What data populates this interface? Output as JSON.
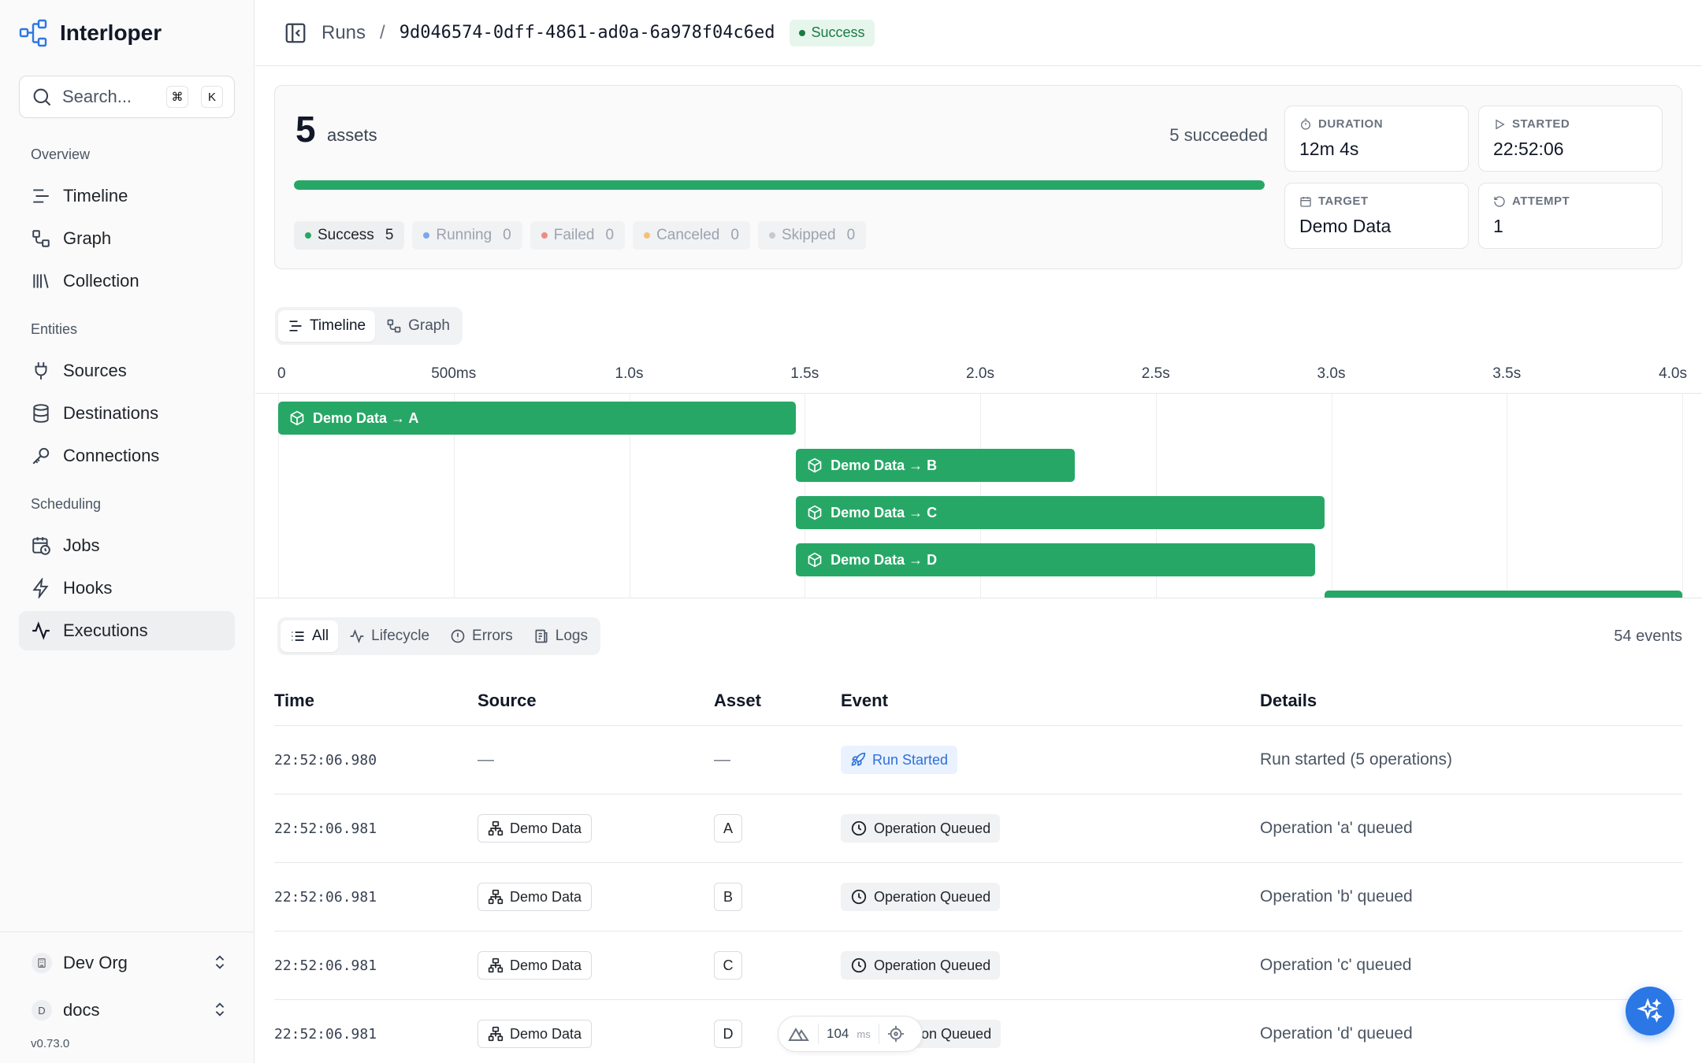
{
  "app": {
    "name": "Interloper",
    "version": "v0.73.0"
  },
  "search": {
    "placeholder": "Search...",
    "shortcut_mod": "⌘",
    "shortcut_key": "K"
  },
  "sidebar": {
    "sections": [
      {
        "title": "Overview",
        "items": [
          {
            "label": "Timeline",
            "icon": "timeline-icon"
          },
          {
            "label": "Graph",
            "icon": "graph-icon"
          },
          {
            "label": "Collection",
            "icon": "library-icon"
          }
        ]
      },
      {
        "title": "Entities",
        "items": [
          {
            "label": "Sources",
            "icon": "plug-icon"
          },
          {
            "label": "Destinations",
            "icon": "database-icon"
          },
          {
            "label": "Connections",
            "icon": "key-icon"
          }
        ]
      },
      {
        "title": "Scheduling",
        "items": [
          {
            "label": "Jobs",
            "icon": "calendar-clock-icon"
          },
          {
            "label": "Hooks",
            "icon": "zap-icon"
          },
          {
            "label": "Executions",
            "icon": "activity-icon",
            "active": true
          }
        ]
      }
    ],
    "org": {
      "name": "Dev Org"
    },
    "project": {
      "initial": "D",
      "name": "docs"
    }
  },
  "header": {
    "breadcrumb_root": "Runs",
    "separator": "/",
    "run_id": "9d046574-0dff-4861-ad0a-6a978f04c6ed",
    "status": "Success",
    "status_color": "#27a766"
  },
  "summary": {
    "asset_count": "5",
    "asset_word": "assets",
    "succeeded_text": "5 succeeded",
    "progress_fraction": 1.0,
    "chips": [
      {
        "label": "Success",
        "count": "5",
        "color": "#27a766",
        "active": true
      },
      {
        "label": "Running",
        "count": "0",
        "color": "#7aa7f0"
      },
      {
        "label": "Failed",
        "count": "0",
        "color": "#ef8a82"
      },
      {
        "label": "Canceled",
        "count": "0",
        "color": "#f5c07a"
      },
      {
        "label": "Skipped",
        "count": "0",
        "color": "#c7c9cc"
      }
    ],
    "stats": [
      {
        "label": "DURATION",
        "value": "12m 4s",
        "icon": "timer-icon"
      },
      {
        "label": "STARTED",
        "value": "22:52:06",
        "icon": "play-icon"
      },
      {
        "label": "TARGET",
        "value": "Demo Data",
        "icon": "calendar-icon"
      },
      {
        "label": "ATTEMPT",
        "value": "1",
        "icon": "rotate-icon"
      }
    ]
  },
  "view_toggle": {
    "options": [
      "Timeline",
      "Graph"
    ],
    "selected": "Timeline"
  },
  "timeline": {
    "ticks": [
      {
        "label": "0",
        "t": 0.0
      },
      {
        "label": "500ms",
        "t": 0.5
      },
      {
        "label": "1.0s",
        "t": 1.0
      },
      {
        "label": "1.5s",
        "t": 1.5
      },
      {
        "label": "2.0s",
        "t": 2.0
      },
      {
        "label": "2.5s",
        "t": 2.5
      },
      {
        "label": "3.0s",
        "t": 3.0
      },
      {
        "label": "3.5s",
        "t": 3.5
      },
      {
        "label": "4.0s",
        "t": 4.0
      }
    ],
    "max_seconds": 4.0,
    "bar_color": "#27a766",
    "bars": [
      {
        "label": "Demo Data → A",
        "start": 0.0,
        "end": 1.475
      },
      {
        "label": "Demo Data → B",
        "start": 1.475,
        "end": 2.27
      },
      {
        "label": "Demo Data → C",
        "start": 1.475,
        "end": 2.98
      },
      {
        "label": "Demo Data → D",
        "start": 1.475,
        "end": 2.955
      },
      {
        "label": "",
        "start": 2.98,
        "end": 4.0
      }
    ]
  },
  "events": {
    "tabs": [
      "All",
      "Lifecycle",
      "Errors",
      "Logs"
    ],
    "selected_tab": "All",
    "count_text": "54 events",
    "columns": [
      "Time",
      "Source",
      "Asset",
      "Event",
      "Details"
    ],
    "rows": [
      {
        "time": "22:52:06.980",
        "source": "—",
        "asset": "—",
        "event": "Run Started",
        "event_icon": "rocket-icon",
        "details": "Run started (5 operations)"
      },
      {
        "time": "22:52:06.981",
        "source": "Demo Data",
        "asset": "A",
        "event": "Operation Queued",
        "event_icon": "clock-icon",
        "details": "Operation 'a' queued"
      },
      {
        "time": "22:52:06.981",
        "source": "Demo Data",
        "asset": "B",
        "event": "Operation Queued",
        "event_icon": "clock-icon",
        "details": "Operation 'b' queued"
      },
      {
        "time": "22:52:06.981",
        "source": "Demo Data",
        "asset": "C",
        "event": "Operation Queued",
        "event_icon": "clock-icon",
        "details": "Operation 'c' queued"
      },
      {
        "time": "22:52:06.981",
        "source": "Demo Data",
        "asset": "D",
        "event": "on Queued",
        "event_icon": "clock-icon",
        "details": "Operation 'd' queued"
      }
    ]
  },
  "devtools": {
    "latency": "104",
    "unit": "ms"
  }
}
